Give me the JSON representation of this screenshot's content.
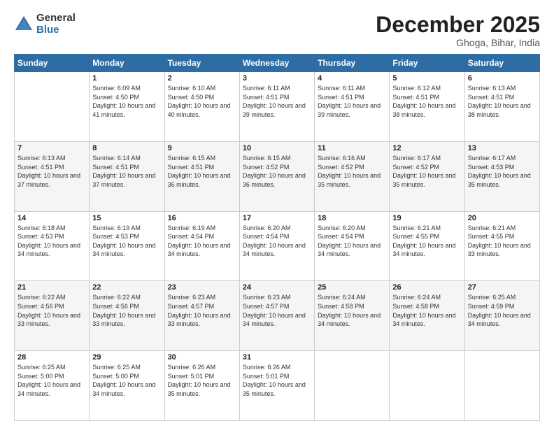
{
  "logo": {
    "general": "General",
    "blue": "Blue"
  },
  "header": {
    "month": "December 2025",
    "location": "Ghoga, Bihar, India"
  },
  "weekdays": [
    "Sunday",
    "Monday",
    "Tuesday",
    "Wednesday",
    "Thursday",
    "Friday",
    "Saturday"
  ],
  "weeks": [
    [
      {
        "day": "",
        "sunrise": "",
        "sunset": "",
        "daylight": ""
      },
      {
        "day": "1",
        "sunrise": "Sunrise: 6:09 AM",
        "sunset": "Sunset: 4:50 PM",
        "daylight": "Daylight: 10 hours and 41 minutes."
      },
      {
        "day": "2",
        "sunrise": "Sunrise: 6:10 AM",
        "sunset": "Sunset: 4:50 PM",
        "daylight": "Daylight: 10 hours and 40 minutes."
      },
      {
        "day": "3",
        "sunrise": "Sunrise: 6:11 AM",
        "sunset": "Sunset: 4:51 PM",
        "daylight": "Daylight: 10 hours and 39 minutes."
      },
      {
        "day": "4",
        "sunrise": "Sunrise: 6:11 AM",
        "sunset": "Sunset: 4:51 PM",
        "daylight": "Daylight: 10 hours and 39 minutes."
      },
      {
        "day": "5",
        "sunrise": "Sunrise: 6:12 AM",
        "sunset": "Sunset: 4:51 PM",
        "daylight": "Daylight: 10 hours and 38 minutes."
      },
      {
        "day": "6",
        "sunrise": "Sunrise: 6:13 AM",
        "sunset": "Sunset: 4:51 PM",
        "daylight": "Daylight: 10 hours and 38 minutes."
      }
    ],
    [
      {
        "day": "7",
        "sunrise": "Sunrise: 6:13 AM",
        "sunset": "Sunset: 4:51 PM",
        "daylight": "Daylight: 10 hours and 37 minutes."
      },
      {
        "day": "8",
        "sunrise": "Sunrise: 6:14 AM",
        "sunset": "Sunset: 4:51 PM",
        "daylight": "Daylight: 10 hours and 37 minutes."
      },
      {
        "day": "9",
        "sunrise": "Sunrise: 6:15 AM",
        "sunset": "Sunset: 4:51 PM",
        "daylight": "Daylight: 10 hours and 36 minutes."
      },
      {
        "day": "10",
        "sunrise": "Sunrise: 6:15 AM",
        "sunset": "Sunset: 4:52 PM",
        "daylight": "Daylight: 10 hours and 36 minutes."
      },
      {
        "day": "11",
        "sunrise": "Sunrise: 6:16 AM",
        "sunset": "Sunset: 4:52 PM",
        "daylight": "Daylight: 10 hours and 35 minutes."
      },
      {
        "day": "12",
        "sunrise": "Sunrise: 6:17 AM",
        "sunset": "Sunset: 4:52 PM",
        "daylight": "Daylight: 10 hours and 35 minutes."
      },
      {
        "day": "13",
        "sunrise": "Sunrise: 6:17 AM",
        "sunset": "Sunset: 4:53 PM",
        "daylight": "Daylight: 10 hours and 35 minutes."
      }
    ],
    [
      {
        "day": "14",
        "sunrise": "Sunrise: 6:18 AM",
        "sunset": "Sunset: 4:53 PM",
        "daylight": "Daylight: 10 hours and 34 minutes."
      },
      {
        "day": "15",
        "sunrise": "Sunrise: 6:19 AM",
        "sunset": "Sunset: 4:53 PM",
        "daylight": "Daylight: 10 hours and 34 minutes."
      },
      {
        "day": "16",
        "sunrise": "Sunrise: 6:19 AM",
        "sunset": "Sunset: 4:54 PM",
        "daylight": "Daylight: 10 hours and 34 minutes."
      },
      {
        "day": "17",
        "sunrise": "Sunrise: 6:20 AM",
        "sunset": "Sunset: 4:54 PM",
        "daylight": "Daylight: 10 hours and 34 minutes."
      },
      {
        "day": "18",
        "sunrise": "Sunrise: 6:20 AM",
        "sunset": "Sunset: 4:54 PM",
        "daylight": "Daylight: 10 hours and 34 minutes."
      },
      {
        "day": "19",
        "sunrise": "Sunrise: 6:21 AM",
        "sunset": "Sunset: 4:55 PM",
        "daylight": "Daylight: 10 hours and 34 minutes."
      },
      {
        "day": "20",
        "sunrise": "Sunrise: 6:21 AM",
        "sunset": "Sunset: 4:55 PM",
        "daylight": "Daylight: 10 hours and 33 minutes."
      }
    ],
    [
      {
        "day": "21",
        "sunrise": "Sunrise: 6:22 AM",
        "sunset": "Sunset: 4:56 PM",
        "daylight": "Daylight: 10 hours and 33 minutes."
      },
      {
        "day": "22",
        "sunrise": "Sunrise: 6:22 AM",
        "sunset": "Sunset: 4:56 PM",
        "daylight": "Daylight: 10 hours and 33 minutes."
      },
      {
        "day": "23",
        "sunrise": "Sunrise: 6:23 AM",
        "sunset": "Sunset: 4:57 PM",
        "daylight": "Daylight: 10 hours and 33 minutes."
      },
      {
        "day": "24",
        "sunrise": "Sunrise: 6:23 AM",
        "sunset": "Sunset: 4:57 PM",
        "daylight": "Daylight: 10 hours and 34 minutes."
      },
      {
        "day": "25",
        "sunrise": "Sunrise: 6:24 AM",
        "sunset": "Sunset: 4:58 PM",
        "daylight": "Daylight: 10 hours and 34 minutes."
      },
      {
        "day": "26",
        "sunrise": "Sunrise: 6:24 AM",
        "sunset": "Sunset: 4:58 PM",
        "daylight": "Daylight: 10 hours and 34 minutes."
      },
      {
        "day": "27",
        "sunrise": "Sunrise: 6:25 AM",
        "sunset": "Sunset: 4:59 PM",
        "daylight": "Daylight: 10 hours and 34 minutes."
      }
    ],
    [
      {
        "day": "28",
        "sunrise": "Sunrise: 6:25 AM",
        "sunset": "Sunset: 5:00 PM",
        "daylight": "Daylight: 10 hours and 34 minutes."
      },
      {
        "day": "29",
        "sunrise": "Sunrise: 6:25 AM",
        "sunset": "Sunset: 5:00 PM",
        "daylight": "Daylight: 10 hours and 34 minutes."
      },
      {
        "day": "30",
        "sunrise": "Sunrise: 6:26 AM",
        "sunset": "Sunset: 5:01 PM",
        "daylight": "Daylight: 10 hours and 35 minutes."
      },
      {
        "day": "31",
        "sunrise": "Sunrise: 6:26 AM",
        "sunset": "Sunset: 5:01 PM",
        "daylight": "Daylight: 10 hours and 35 minutes."
      },
      {
        "day": "",
        "sunrise": "",
        "sunset": "",
        "daylight": ""
      },
      {
        "day": "",
        "sunrise": "",
        "sunset": "",
        "daylight": ""
      },
      {
        "day": "",
        "sunrise": "",
        "sunset": "",
        "daylight": ""
      }
    ]
  ]
}
